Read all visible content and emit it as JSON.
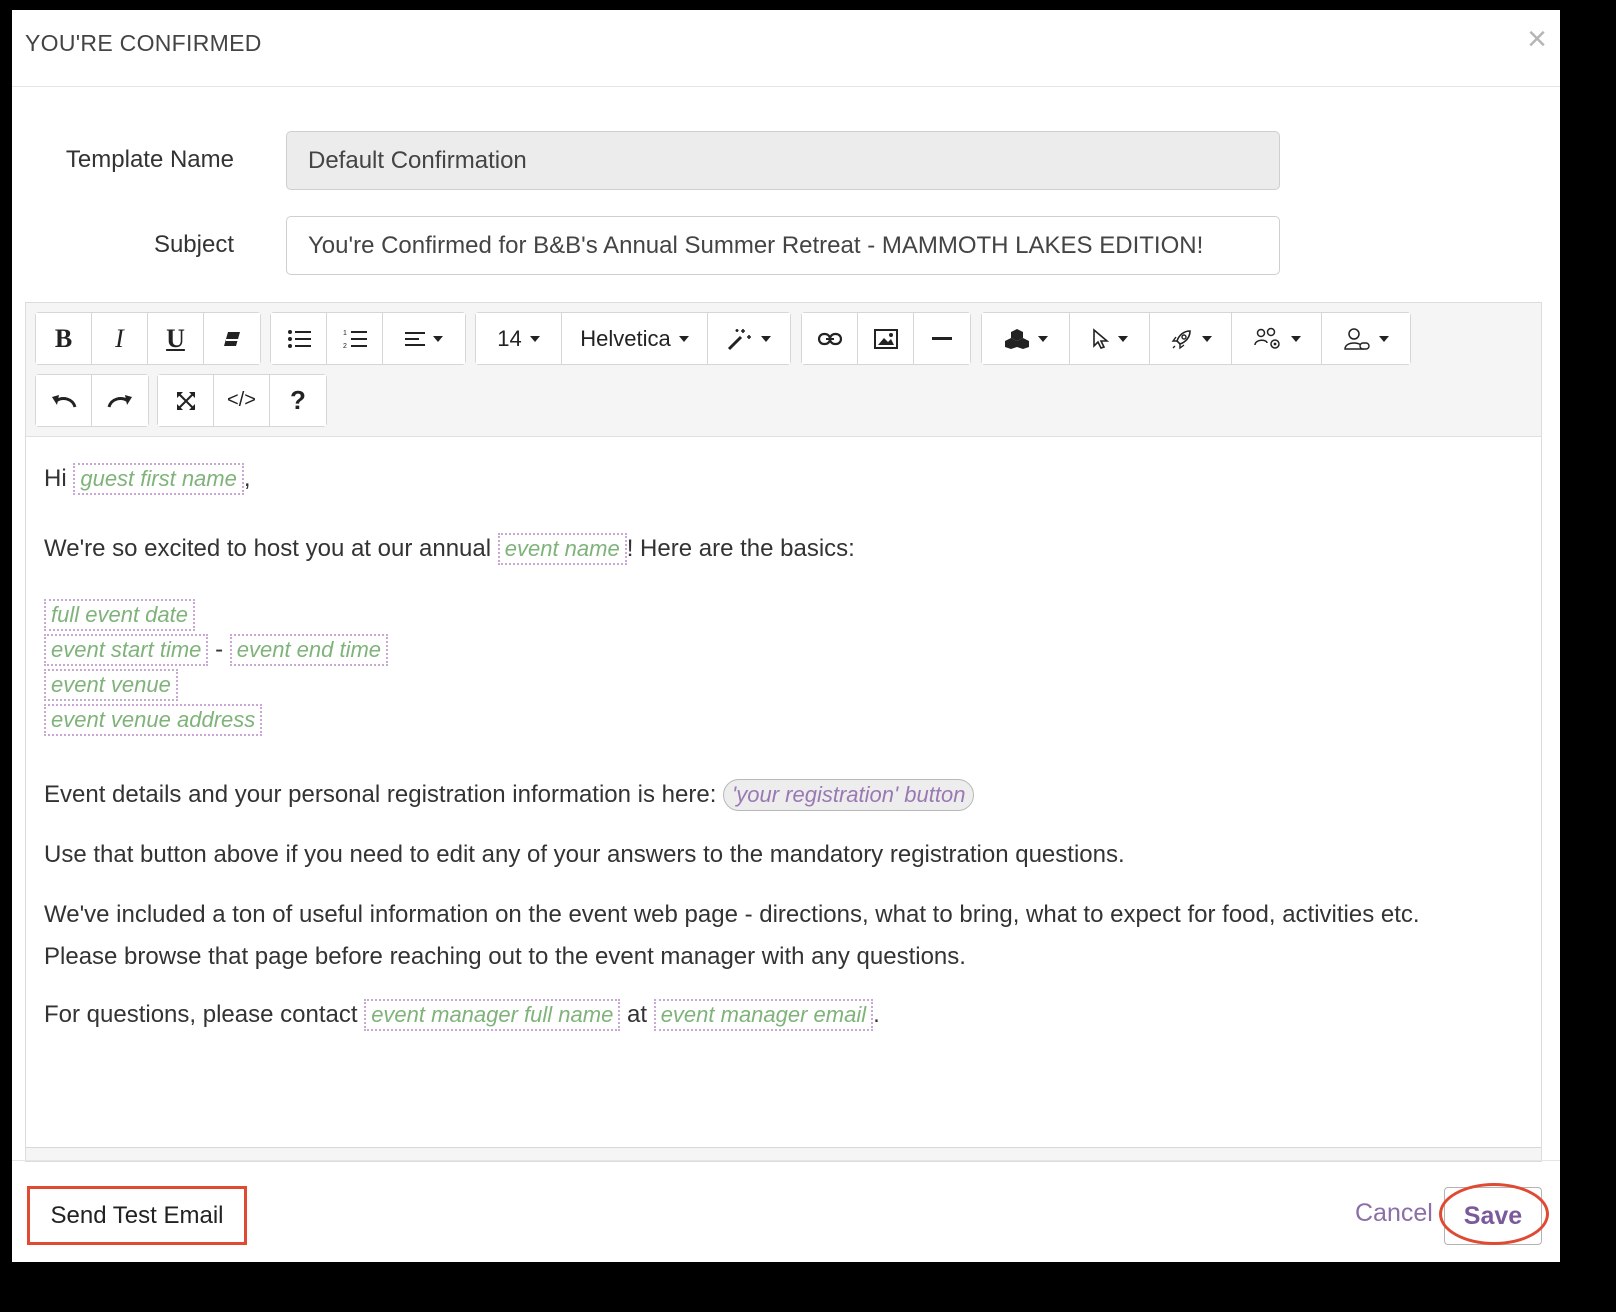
{
  "modal": {
    "title": "YOU'RE CONFIRMED",
    "close_icon": "close-icon"
  },
  "form": {
    "template_name_label": "Template Name",
    "template_name_value": "Default Confirmation",
    "subject_label": "Subject",
    "subject_value": "You're Confirmed for B&B's Annual Summer Retreat - MAMMOTH LAKES EDITION!"
  },
  "toolbar": {
    "font_size": "14",
    "font_family": "Helvetica",
    "bold": "B",
    "italic": "I",
    "underline": "U",
    "help": "?",
    "code": "</>"
  },
  "body": {
    "greeting": "Hi",
    "guest_first_name": "guest first name",
    "greeting_end": ",",
    "intro_before": "We're so excited to host you at our annual",
    "event_name": "event name",
    "intro_after": "! Here are the basics:",
    "full_event_date": "full event date",
    "event_start_time": "event start time",
    "dash": "-",
    "event_end_time": "event end time",
    "event_venue": "event venue",
    "event_venue_address": "event venue address",
    "details_text": "Event details and your personal registration information is here:",
    "registration_button": "'your registration' button",
    "use_button_text": "Use that button above if you need to edit any of your answers to the mandatory registration questions.",
    "info_line1": "We've included a ton of useful information on the event web page - directions, what to bring, what to expect for food, activities etc.",
    "info_line2": "Please browse that page before reaching out to the event manager with any questions.",
    "contact_before": "For questions, please contact",
    "event_manager_full_name": "event manager full name",
    "contact_at": "at",
    "event_manager_email": "event manager email",
    "contact_end": "."
  },
  "footer": {
    "send_test_email": "Send Test Email",
    "cancel": "Cancel",
    "save": "Save"
  },
  "colors": {
    "accent": "#8a6fa8",
    "highlight": "#e04a32",
    "tag_text": "#7fb37a"
  }
}
